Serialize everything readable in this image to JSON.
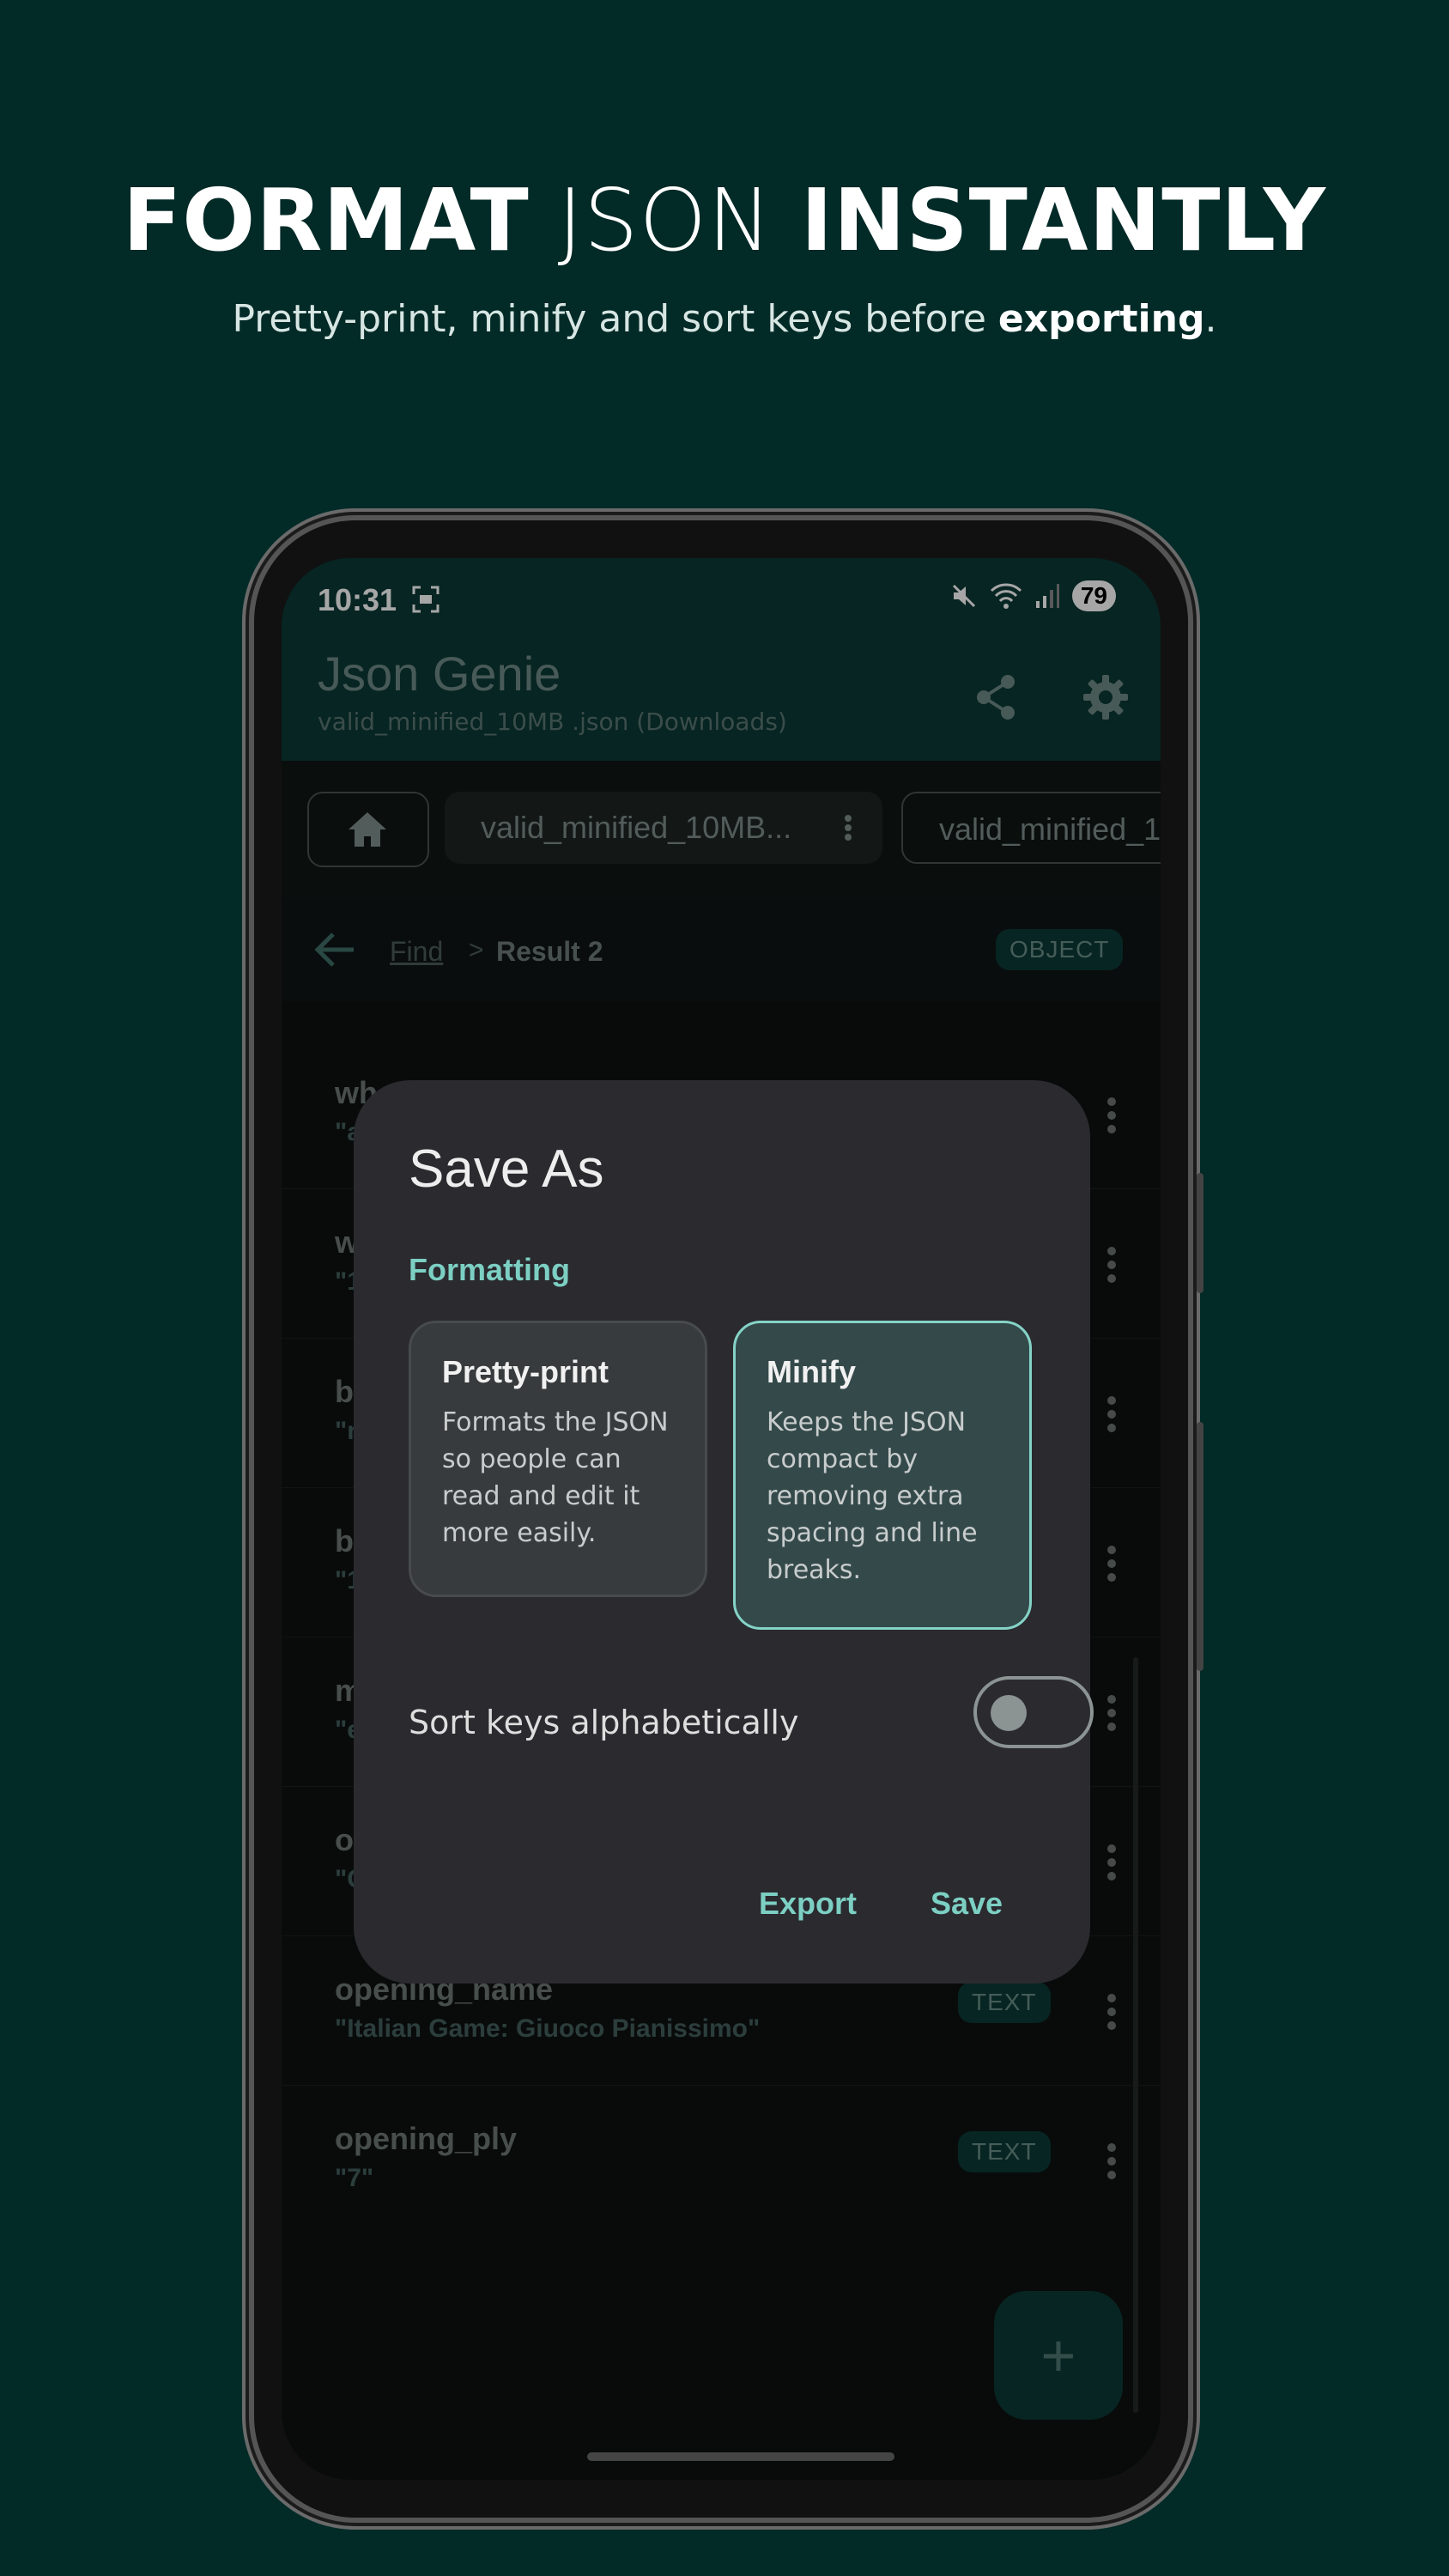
{
  "promo": {
    "headline_bold1": "FORMAT",
    "headline_light": "JSON",
    "headline_bold2": "INSTANTLY",
    "sub_before": "Pretty-print, minify and sort keys before ",
    "sub_bold": "exporting",
    "sub_after": "."
  },
  "status": {
    "time": "10:31",
    "battery": "79"
  },
  "appbar": {
    "title": "Json Genie",
    "subtitle": "valid_minified_10MB .json (Downloads)"
  },
  "tabs": [
    {
      "label": "valid_minified_10MB..."
    },
    {
      "label": "valid_minified_1"
    }
  ],
  "breadcrumb": {
    "find": "Find",
    "sep": ">",
    "current": "Result 2",
    "type_badge": "OBJECT"
  },
  "rows": [
    {
      "key": "wh",
      "value": "\"a",
      "badge": ""
    },
    {
      "key": "w",
      "value": "\"1",
      "badge": ""
    },
    {
      "key": "b",
      "value": "\"r",
      "badge": ""
    },
    {
      "key": "b",
      "value": "\"1",
      "badge": ""
    },
    {
      "key": "m",
      "value": "\"e",
      "badge": ""
    },
    {
      "key": "o",
      "value": "\"C",
      "badge": ""
    },
    {
      "key": "opening_name",
      "value": "\"Italian Game: Giuoco Pianissimo\"",
      "badge": "TEXT"
    },
    {
      "key": "opening_ply",
      "value": "\"7\"",
      "badge": "TEXT"
    }
  ],
  "fab": {
    "label": "+"
  },
  "dialog": {
    "title": "Save As",
    "section": "Formatting",
    "options": [
      {
        "title": "Pretty-print",
        "desc": "Formats the JSON so people can read and edit it more easily.",
        "selected": false
      },
      {
        "title": "Minify",
        "desc": "Keeps the JSON compact by removing extra spacing and line breaks.",
        "selected": true
      }
    ],
    "sort_label": "Sort keys alphabetically",
    "sort_enabled": false,
    "export_label": "Export",
    "save_label": "Save"
  },
  "colors": {
    "background": "#022a27",
    "accent": "#7ccfc3",
    "appbar": "#0b3a35",
    "dialog": "#2a2a2f"
  }
}
